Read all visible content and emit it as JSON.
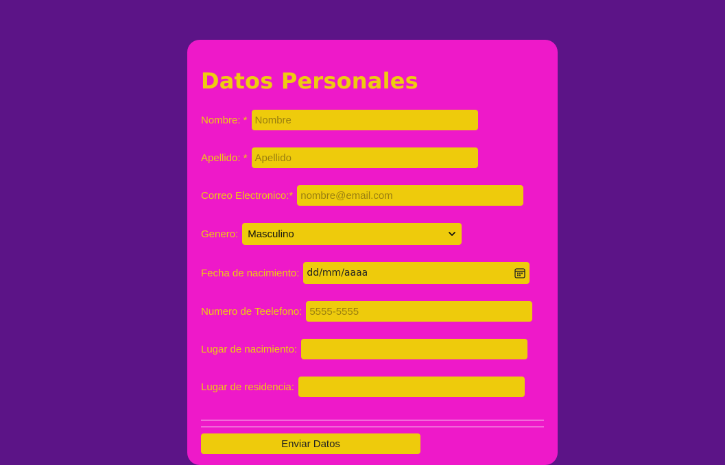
{
  "form": {
    "title": "Datos Personales",
    "fields": {
      "nombre": {
        "label": "Nombre: *",
        "placeholder": "Nombre"
      },
      "apellido": {
        "label": "Apellido: *",
        "placeholder": "Apellido"
      },
      "correo": {
        "label": "Correo Electronico:*",
        "placeholder": "nombre@email.com"
      },
      "genero": {
        "label": "Genero:",
        "selected": "Masculino"
      },
      "fecha": {
        "label": "Fecha de nacimiento:",
        "value": "dd/mm/aaaa"
      },
      "telefono": {
        "label": "Numero de Teelefono:",
        "placeholder": "5555-5555"
      },
      "lugar_nacimiento": {
        "label": "Lugar de nacimiento:",
        "placeholder": ""
      },
      "lugar_residencia": {
        "label": "Lugar de residencia:",
        "placeholder": ""
      }
    },
    "submit_label": "Enviar Datos"
  },
  "colors": {
    "background": "#5c1487",
    "card": "#ee19c9",
    "accent": "#eecb10"
  },
  "icons": {
    "genero_dropdown": "chevron-down-icon",
    "fecha_picker": "calendar-icon"
  }
}
